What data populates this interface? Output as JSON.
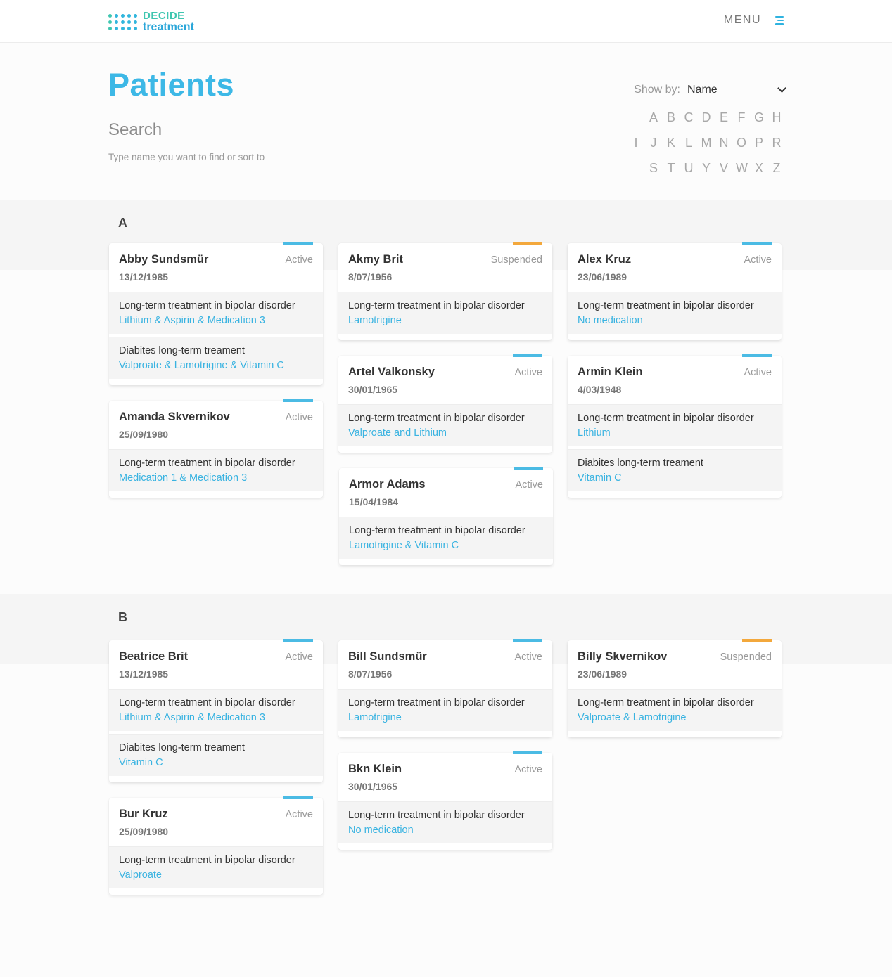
{
  "header": {
    "logo_line1": "DECIDE",
    "logo_line2": "treatment",
    "menu_label": "MENU"
  },
  "page": {
    "title": "Patients",
    "search_placeholder": "Search",
    "search_hint": "Type name you want to find or sort to",
    "show_by_label": "Show by:",
    "show_by_value": "Name"
  },
  "alphabet": {
    "row1": [
      "A",
      "B",
      "C",
      "D",
      "E",
      "F",
      "G",
      "H"
    ],
    "row2": [
      "I",
      "J",
      "K",
      "L",
      "M",
      "N",
      "O",
      "P",
      "R"
    ],
    "row3": [
      "S",
      "T",
      "U",
      "Y",
      "V",
      "W",
      "X",
      "Z"
    ]
  },
  "colors": {
    "accent": "#3db8e6",
    "active_bar": "#4bbbe4",
    "suspended_bar": "#f3a83c"
  },
  "groups": [
    {
      "letter": "A",
      "patients": [
        {
          "name": "Abby Sundsmür",
          "status": "Active",
          "dob": "13/12/1985",
          "treatments": [
            {
              "desc": "Long-term treatment in bipolar disorder",
              "meds": "Lithium & Aspirin & Medication 3"
            },
            {
              "desc": "Diabites long-term treament",
              "meds": "Valproate & Lamotrigine & Vitamin C"
            }
          ]
        },
        {
          "name": "Akmy Brit",
          "status": "Suspended",
          "dob": "8/07/1956",
          "treatments": [
            {
              "desc": "Long-term treatment in bipolar disorder",
              "meds": "Lamotrigine"
            }
          ]
        },
        {
          "name": "Alex Kruz",
          "status": "Active",
          "dob": "23/06/1989",
          "treatments": [
            {
              "desc": "Long-term treatment in bipolar disorder",
              "meds": "No medication"
            }
          ]
        },
        {
          "name": "Amanda Skvernikov",
          "status": "Active",
          "dob": "25/09/1980",
          "treatments": [
            {
              "desc": "Long-term treatment in bipolar disorder",
              "meds": "Medication 1 & Medication 3"
            }
          ]
        },
        {
          "name": "Artel Valkonsky",
          "status": "Active",
          "dob": "30/01/1965",
          "treatments": [
            {
              "desc": "Long-term treatment in bipolar disorder",
              "meds": "Valproate and Lithium"
            }
          ]
        },
        {
          "name": "Armin Klein",
          "status": "Active",
          "dob": "4/03/1948",
          "treatments": [
            {
              "desc": "Long-term treatment in bipolar disorder",
              "meds": "Lithium"
            },
            {
              "desc": "Diabites long-term treament",
              "meds": "Vitamin C"
            }
          ]
        },
        {
          "name": "Armor Adams",
          "status": "Active",
          "dob": "15/04/1984",
          "treatments": [
            {
              "desc": "Long-term treatment in bipolar disorder",
              "meds": "Lamotrigine & Vitamin C"
            }
          ]
        }
      ]
    },
    {
      "letter": "B",
      "patients": [
        {
          "name": "Beatrice Brit",
          "status": "Active",
          "dob": "13/12/1985",
          "treatments": [
            {
              "desc": "Long-term treatment in bipolar disorder",
              "meds": "Lithium & Aspirin & Medication 3"
            },
            {
              "desc": "Diabites long-term treament",
              "meds": "Vitamin C"
            }
          ]
        },
        {
          "name": "Bill Sundsmür",
          "status": "Active",
          "dob": "8/07/1956",
          "treatments": [
            {
              "desc": "Long-term treatment in bipolar disorder",
              "meds": "Lamotrigine"
            }
          ]
        },
        {
          "name": "Billy Skvernikov",
          "status": "Suspended",
          "dob": "23/06/1989",
          "treatments": [
            {
              "desc": "Long-term treatment in bipolar disorder",
              "meds": "Valproate & Lamotrigine"
            }
          ]
        },
        {
          "name": "Bur Kruz",
          "status": "Active",
          "dob": "25/09/1980",
          "treatments": [
            {
              "desc": "Long-term treatment in bipolar disorder",
              "meds": "Valproate"
            }
          ]
        },
        {
          "name": "Bkn Klein",
          "status": "Active",
          "dob": "30/01/1965",
          "treatments": [
            {
              "desc": "Long-term treatment in bipolar disorder",
              "meds": "No medication"
            }
          ]
        }
      ]
    }
  ]
}
